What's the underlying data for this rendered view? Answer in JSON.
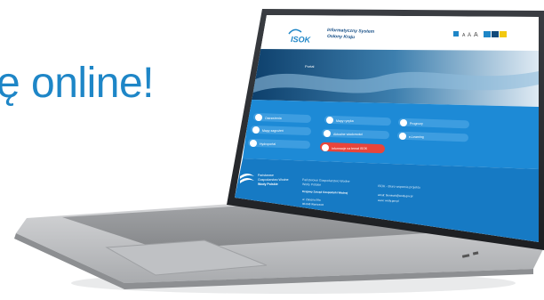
{
  "headline": "ę online!",
  "site": {
    "logo": "ISOK",
    "title_line1": "Informatyczny System",
    "title_line2": "Osłony Kraju",
    "header_controls": [
      "A",
      "A",
      "A"
    ],
    "hero_badge": "Portal"
  },
  "tiles": [
    {
      "label": "Ostrzeżenia"
    },
    {
      "label": "Mapy ryzyka"
    },
    {
      "label": "Prognozy"
    },
    {
      "label": "Mapy zagrożeń"
    },
    {
      "label": "Aktualne wiadomości"
    },
    {
      "label": "e-Learning"
    },
    {
      "label": "Hydroportal"
    },
    {
      "label": "Informacje na temat ISOK"
    }
  ],
  "footer": {
    "org_logo_line1": "Państwowe",
    "org_logo_line2": "Gospodarstwo Wodne",
    "org_logo_line3": "Wody Polskie",
    "col2_line1": "Państwowe Gospodarstwo Wodne",
    "col2_line2": "Wody Polskie",
    "col2_line3": "Krajowy Zarząd Gospodarki Wodnej",
    "col2_line4": "ul. Żelazna 59a",
    "col2_line5": "00-848 Warszawa",
    "col3_line1": "ISOK - Biuro wsparcia projektu",
    "col3_line2": "email: biuroisok@wody.gov.pl",
    "col3_line3": "www: wody.gov.pl"
  },
  "colors": {
    "accent_blue": "#1e86c7",
    "tile_blue": "#1d8ad6",
    "tile_red": "#e8453a",
    "footer_blue": "#167ac4"
  }
}
